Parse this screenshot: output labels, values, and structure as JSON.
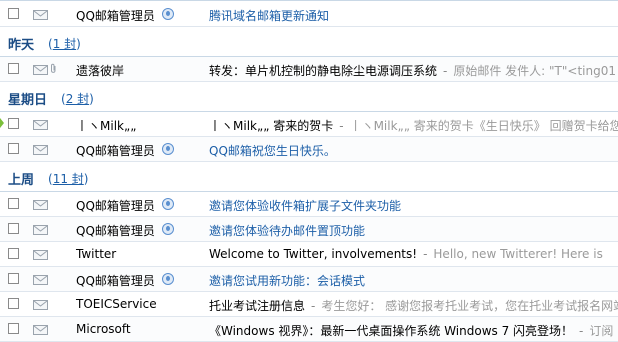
{
  "groups": [
    {
      "title": "",
      "count": "",
      "rows": [
        {
          "sender": "QQ邮箱管理员",
          "badge": true,
          "attachment": false,
          "subject": "腾讯域名邮箱更新通知",
          "subject_style": "link",
          "preview": ""
        }
      ]
    },
    {
      "title": "昨天",
      "count": "1 封",
      "rows": [
        {
          "sender": "遗落彼岸",
          "badge": false,
          "attachment": true,
          "subject": "转发：单片机控制的静电除尘电源调压系统",
          "subject_style": "text",
          "preview": "原始邮件 发件人: \"T\"<ting01"
        }
      ]
    },
    {
      "title": "星期日",
      "count": "2 封",
      "rows": [
        {
          "sender": "丨ヽMilk„„",
          "badge": false,
          "attachment": false,
          "subject": "丨ヽMilk„„ 寄来的贺卡",
          "subject_style": "text",
          "preview": "丨ヽMilk„„ 寄来的贺卡《生日快乐》 回赠贺卡给您",
          "current": true
        },
        {
          "sender": "QQ邮箱管理员",
          "badge": true,
          "attachment": false,
          "subject": "QQ邮箱祝您生日快乐。",
          "subject_style": "link",
          "preview": ""
        }
      ]
    },
    {
      "title": "上周",
      "count": "11 封",
      "rows": [
        {
          "sender": "QQ邮箱管理员",
          "badge": true,
          "attachment": false,
          "subject": "邀请您体验收件箱扩展子文件夹功能",
          "subject_style": "link",
          "preview": ""
        },
        {
          "sender": "QQ邮箱管理员",
          "badge": true,
          "attachment": false,
          "subject": "邀请您体验待办邮件置顶功能",
          "subject_style": "link",
          "preview": ""
        },
        {
          "sender": "Twitter",
          "badge": false,
          "attachment": false,
          "subject": "Welcome to Twitter, involvements!",
          "subject_style": "text",
          "preview": "Hello, new Twitterer! Here is"
        },
        {
          "sender": "QQ邮箱管理员",
          "badge": true,
          "attachment": false,
          "subject": "邀请您试用新功能：会话模式",
          "subject_style": "link",
          "preview": ""
        },
        {
          "sender": "TOEICService",
          "badge": false,
          "attachment": false,
          "subject": "托业考试注册信息",
          "subject_style": "text",
          "preview": "考生您好： 感谢您报考托业考试，您在托业考试报名网站"
        },
        {
          "sender": "Microsoft",
          "badge": false,
          "attachment": false,
          "subject": "《Windows 视界》：最新一代桌面操作系统 Windows 7 闪亮登场！",
          "subject_style": "text",
          "preview": "订阅"
        }
      ]
    }
  ],
  "separator": "-"
}
